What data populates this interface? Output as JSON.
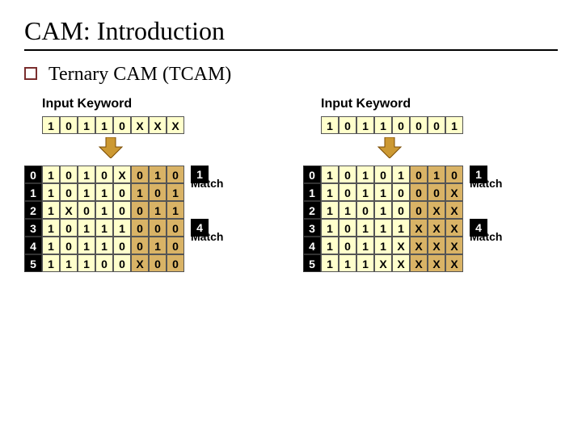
{
  "title": "CAM: Introduction",
  "subtitle": "Ternary CAM (TCAM)",
  "input_label": "Input Keyword",
  "match_label": "Match",
  "left": {
    "keyword": [
      "1",
      "0",
      "1",
      "1",
      "0",
      "X",
      "X",
      "X"
    ],
    "rows": [
      {
        "idx": "0",
        "cells": [
          "1",
          "0",
          "1",
          "0",
          "X",
          "0",
          "1",
          "0"
        ],
        "badge": "1",
        "match_below": true
      },
      {
        "idx": "1",
        "cells": [
          "1",
          "0",
          "1",
          "1",
          "0",
          "1",
          "0",
          "1"
        ]
      },
      {
        "idx": "2",
        "cells": [
          "1",
          "X",
          "0",
          "1",
          "0",
          "0",
          "1",
          "1"
        ]
      },
      {
        "idx": "3",
        "cells": [
          "1",
          "0",
          "1",
          "1",
          "1",
          "0",
          "0",
          "0"
        ],
        "badge": "4",
        "match_below": true
      },
      {
        "idx": "4",
        "cells": [
          "1",
          "0",
          "1",
          "1",
          "0",
          "0",
          "1",
          "0"
        ]
      },
      {
        "idx": "5",
        "cells": [
          "1",
          "1",
          "1",
          "0",
          "0",
          "X",
          "0",
          "0"
        ]
      }
    ]
  },
  "right": {
    "keyword": [
      "1",
      "0",
      "1",
      "1",
      "0",
      "0",
      "0",
      "1"
    ],
    "rows": [
      {
        "idx": "0",
        "cells": [
          "1",
          "0",
          "1",
          "0",
          "1",
          "0",
          "1",
          "0"
        ],
        "badge": "1",
        "match_below": true
      },
      {
        "idx": "1",
        "cells": [
          "1",
          "0",
          "1",
          "1",
          "0",
          "0",
          "0",
          "X"
        ]
      },
      {
        "idx": "2",
        "cells": [
          "1",
          "1",
          "0",
          "1",
          "0",
          "0",
          "X",
          "X"
        ]
      },
      {
        "idx": "3",
        "cells": [
          "1",
          "0",
          "1",
          "1",
          "1",
          "X",
          "X",
          "X"
        ],
        "badge": "4",
        "match_below": true
      },
      {
        "idx": "4",
        "cells": [
          "1",
          "0",
          "1",
          "1",
          "X",
          "X",
          "X",
          "X"
        ]
      },
      {
        "idx": "5",
        "cells": [
          "1",
          "1",
          "1",
          "X",
          "X",
          "X",
          "X",
          "X"
        ]
      }
    ]
  }
}
